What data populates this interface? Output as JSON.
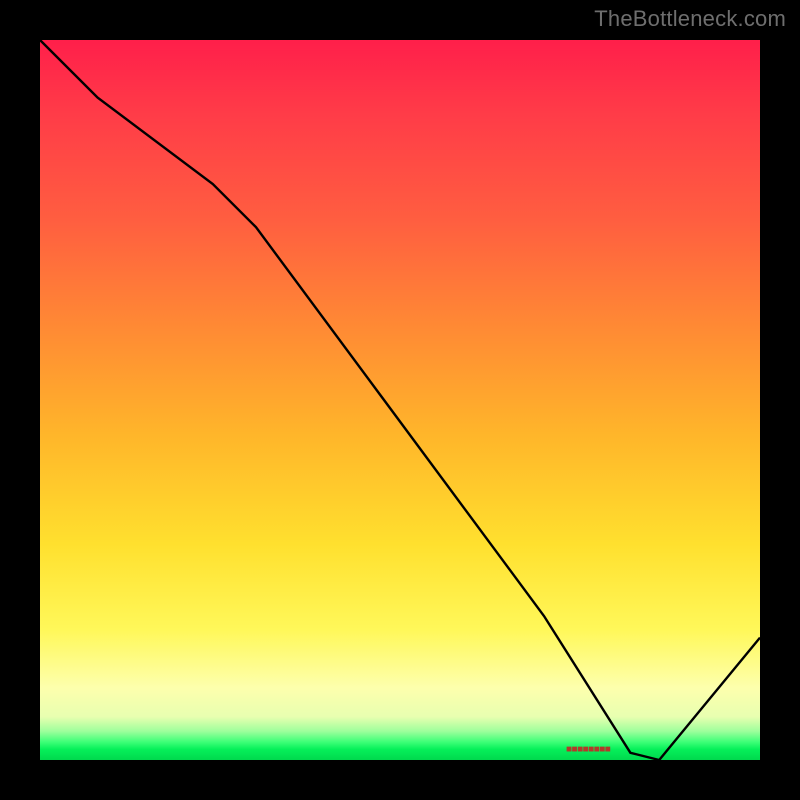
{
  "watermark": "TheBottleneck.com",
  "colors": {
    "curve": "#000000",
    "marker_text": "#b23a2a"
  },
  "marker_label": "■■■■■■■■",
  "chart_data": {
    "type": "line",
    "title": "",
    "xlabel": "",
    "ylabel": "",
    "xlim": [
      0,
      100
    ],
    "ylim": [
      0,
      100
    ],
    "series": [
      {
        "name": "bottleneck-curve",
        "x": [
          0,
          8,
          24,
          30,
          70,
          82,
          86,
          100
        ],
        "values": [
          100,
          92,
          80,
          74,
          20,
          1,
          0,
          17
        ]
      }
    ],
    "annotations": [
      {
        "name": "optimal-region-marker",
        "x": 80,
        "y": 0.5
      }
    ],
    "background_gradient_stops": [
      {
        "pos": 0.0,
        "color": "#ff1f4a"
      },
      {
        "pos": 0.25,
        "color": "#ff5e40"
      },
      {
        "pos": 0.55,
        "color": "#ffb62a"
      },
      {
        "pos": 0.82,
        "color": "#fff85a"
      },
      {
        "pos": 0.94,
        "color": "#e8ffb0"
      },
      {
        "pos": 1.0,
        "color": "#00d94d"
      }
    ]
  }
}
